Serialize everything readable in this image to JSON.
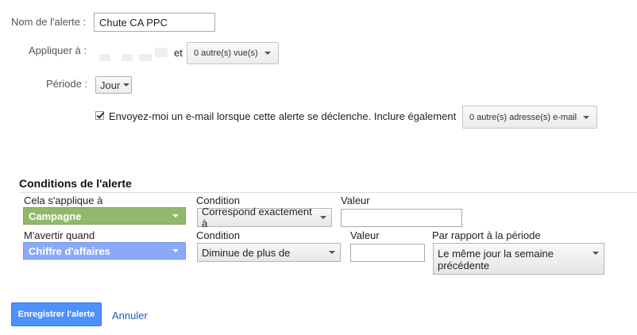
{
  "form": {
    "alert_name_label": "Nom de l'alerte :",
    "alert_name_value": "Chute CA PPC",
    "apply_to_label": "Appliquer à :",
    "apply_to_connector": "et",
    "views_button": "0 autre(s) vue(s)",
    "period_label": "Période :",
    "period_value": "Jour",
    "email_checked": true,
    "email_text": "Envoyez-moi un e-mail lorsque cette alerte se déclenche. Inclure également",
    "email_dropdown": "0 autre(s) adresse(s) e-mail"
  },
  "conditions": {
    "title": "Conditions de l'alerte",
    "applies_to_label": "Cela s'applique à",
    "applies_to_value": "Campagne",
    "condition_label": "Condition",
    "condition_value": "Correspond exactement à",
    "value_label": "Valeur",
    "value_input": "",
    "notify_label": "M'avertir quand",
    "notify_value": "Chiffre d'affaires",
    "condition2_label": "Condition",
    "condition2_value": "Diminue de plus de",
    "value2_label": "Valeur",
    "value2_input": "",
    "relative_label": "Par rapport à la période",
    "relative_value": "Le même jour la semaine précédente"
  },
  "actions": {
    "save_label": "Enregistrer l'alerte",
    "cancel_label": "Annuler"
  },
  "colors": {
    "campaign_green": "#93b86b",
    "metric_blue": "#8aa9f7",
    "primary_blue": "#4d90fe",
    "link_blue": "#1a5fb4"
  }
}
